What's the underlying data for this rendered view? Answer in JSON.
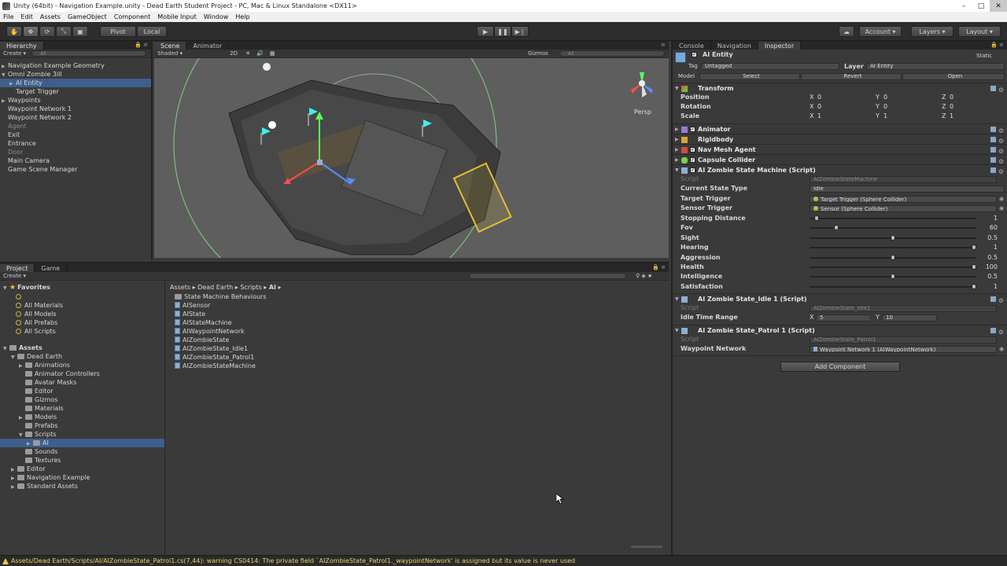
{
  "window": {
    "title": "Unity (64bit) - Navigation Example.unity - Dead Earth Student Project - PC, Mac & Linux Standalone <DX11>",
    "minimize": "–",
    "maximize": "□",
    "close": "✕"
  },
  "menu": [
    "File",
    "Edit",
    "Assets",
    "GameObject",
    "Component",
    "Mobile Input",
    "Window",
    "Help"
  ],
  "toolbar": {
    "pivot": "Pivot",
    "local": "Local",
    "account": "Account",
    "layers": "Layers",
    "layout": "Layout"
  },
  "hierarchy": {
    "tab": "Hierarchy",
    "create": "Create",
    "search_placeholder": "All",
    "items": [
      {
        "label": "Navigation Example Geometry",
        "indent": 0,
        "arrow": "▶",
        "dim": false,
        "selected": false
      },
      {
        "label": "Omni Zombie 3ill",
        "indent": 0,
        "arrow": "▼",
        "dim": false,
        "selected": false
      },
      {
        "label": "AI Entity",
        "indent": 1,
        "arrow": "▶",
        "dim": false,
        "selected": true
      },
      {
        "label": "Target Trigger",
        "indent": 1,
        "arrow": "",
        "dim": false,
        "selected": false
      },
      {
        "label": "Waypoints",
        "indent": 0,
        "arrow": "▶",
        "dim": false,
        "selected": false
      },
      {
        "label": "Waypoint Network 1",
        "indent": 0,
        "arrow": "",
        "dim": false,
        "selected": false
      },
      {
        "label": "Waypoint Network 2",
        "indent": 0,
        "arrow": "",
        "dim": false,
        "selected": false
      },
      {
        "label": "Agent",
        "indent": 0,
        "arrow": "",
        "dim": true,
        "selected": false
      },
      {
        "label": "Exit",
        "indent": 0,
        "arrow": "",
        "dim": false,
        "selected": false
      },
      {
        "label": "Entrance",
        "indent": 0,
        "arrow": "",
        "dim": false,
        "selected": false
      },
      {
        "label": "Door",
        "indent": 0,
        "arrow": "",
        "dim": true,
        "selected": false
      },
      {
        "label": "Main Camera",
        "indent": 0,
        "arrow": "",
        "dim": false,
        "selected": false
      },
      {
        "label": "Game Scene Manager",
        "indent": 0,
        "arrow": "",
        "dim": false,
        "selected": false
      }
    ]
  },
  "scene": {
    "tab_scene": "Scene",
    "tab_animator": "Animator",
    "shaded": "Shaded",
    "twod": "2D",
    "gizmos": "Gizmos",
    "search_placeholder": "All",
    "persp": "Persp"
  },
  "project": {
    "tab_project": "Project",
    "tab_game": "Game",
    "create": "Create",
    "favorites_label": "Favorites",
    "favorites": [
      "All Materials",
      "All Models",
      "All Prefabs",
      "All Scripts"
    ],
    "assets_label": "Assets",
    "tree": [
      {
        "label": "Dead Earth",
        "indent": 1,
        "arrow": "▼",
        "selected": false
      },
      {
        "label": "Animations",
        "indent": 2,
        "arrow": "▶",
        "selected": false
      },
      {
        "label": "Animator Controllers",
        "indent": 2,
        "arrow": "",
        "selected": false
      },
      {
        "label": "Avatar Masks",
        "indent": 2,
        "arrow": "",
        "selected": false
      },
      {
        "label": "Editor",
        "indent": 2,
        "arrow": "",
        "selected": false
      },
      {
        "label": "Gizmos",
        "indent": 2,
        "arrow": "",
        "selected": false
      },
      {
        "label": "Materials",
        "indent": 2,
        "arrow": "",
        "selected": false
      },
      {
        "label": "Models",
        "indent": 2,
        "arrow": "▶",
        "selected": false
      },
      {
        "label": "Prefabs",
        "indent": 2,
        "arrow": "",
        "selected": false
      },
      {
        "label": "Scripts",
        "indent": 2,
        "arrow": "▼",
        "selected": false
      },
      {
        "label": "AI",
        "indent": 3,
        "arrow": "▶",
        "selected": true
      },
      {
        "label": "Sounds",
        "indent": 2,
        "arrow": "",
        "selected": false
      },
      {
        "label": "Textures",
        "indent": 2,
        "arrow": "",
        "selected": false
      },
      {
        "label": "Editor",
        "indent": 1,
        "arrow": "▶",
        "selected": false
      },
      {
        "label": "Navigation Example",
        "indent": 1,
        "arrow": "▶",
        "selected": false
      },
      {
        "label": "Standard Assets",
        "indent": 1,
        "arrow": "▶",
        "selected": false
      }
    ],
    "breadcrumb": [
      "Assets",
      "Dead Earth",
      "Scripts",
      "AI"
    ],
    "files": [
      {
        "label": "State Machine Behaviours",
        "type": "folder"
      },
      {
        "label": "AISensor",
        "type": "script"
      },
      {
        "label": "AIState",
        "type": "script"
      },
      {
        "label": "AIStateMachine",
        "type": "script"
      },
      {
        "label": "AIWaypointNetwork",
        "type": "script"
      },
      {
        "label": "AIZombieState",
        "type": "script"
      },
      {
        "label": "AIZombieState_Idle1",
        "type": "script"
      },
      {
        "label": "AIZombieState_Patrol1",
        "type": "script"
      },
      {
        "label": "AIZombieStateMachine",
        "type": "script"
      }
    ]
  },
  "inspector": {
    "tab_console": "Console",
    "tab_navigation": "Navigation",
    "tab_inspector": "Inspector",
    "object_name": "AI Entity",
    "static": "Static",
    "tag_label": "Tag",
    "tag_value": "Untagged",
    "layer_label": "Layer",
    "layer_value": "AI Entity",
    "model_label": "Model",
    "select": "Select",
    "revert": "Revert",
    "open": "Open",
    "transform": {
      "title": "Transform",
      "position_label": "Position",
      "position": [
        "0",
        "0",
        "0"
      ],
      "rotation_label": "Rotation",
      "rotation": [
        "0",
        "0",
        "0"
      ],
      "scale_label": "Scale",
      "scale": [
        "1",
        "1",
        "1"
      ]
    },
    "axis_x": "X",
    "axis_y": "Y",
    "axis_z": "Z",
    "components": [
      "Animator",
      "Rigidbody",
      "Nav Mesh Agent",
      "Capsule Collider"
    ],
    "state_machine": {
      "title": "AI Zombie State Machine (Script)",
      "script_label": "Script",
      "script_value": "AIZombieStateMachine",
      "current_state_label": "Current State Type",
      "current_state_value": "Idle",
      "target_trigger_label": "Target Trigger",
      "target_trigger_value": "Target Trigger (Sphere Collider)",
      "sensor_trigger_label": "Sensor Trigger",
      "sensor_trigger_value": "Sensor (Sphere Collider)",
      "sliders": [
        {
          "label": "Stopping Distance",
          "value": "1",
          "fraction": 0.03
        },
        {
          "label": "Fov",
          "value": "60",
          "fraction": 0.15
        },
        {
          "label": "Sight",
          "value": "0.5",
          "fraction": 0.5
        },
        {
          "label": "Hearing",
          "value": "1",
          "fraction": 1.0
        },
        {
          "label": "Aggression",
          "value": "0.5",
          "fraction": 0.5
        },
        {
          "label": "Health",
          "value": "100",
          "fraction": 1.0
        },
        {
          "label": "Intelligence",
          "value": "0.5",
          "fraction": 0.5
        },
        {
          "label": "Satisfaction",
          "value": "1",
          "fraction": 1.0
        }
      ]
    },
    "idle": {
      "title": "AI Zombie State_Idle 1 (Script)",
      "script_label": "Script",
      "script_value": "AIZombieState_Idle1",
      "range_label": "Idle Time Range",
      "range_x": "5",
      "range_y": "10"
    },
    "patrol": {
      "title": "AI Zombie State_Patrol 1 (Script)",
      "script_label": "Script",
      "script_value": "AIZombieState_Patrol1",
      "network_label": "Waypoint Network",
      "network_value": "Waypoint Network 1 (AIWaypointNetwork)"
    },
    "add_component": "Add Component"
  },
  "status": {
    "message": "Assets/Dead Earth/Scripts/AI/AIZombieState_Patrol1.cs(7,44): warning CS0414: The private field `AIZombieState_Patrol1._waypointNetwork' is assigned but its value is never used"
  },
  "colors": {
    "selection": "#3e5f8c",
    "warning": "#e7d36b"
  }
}
